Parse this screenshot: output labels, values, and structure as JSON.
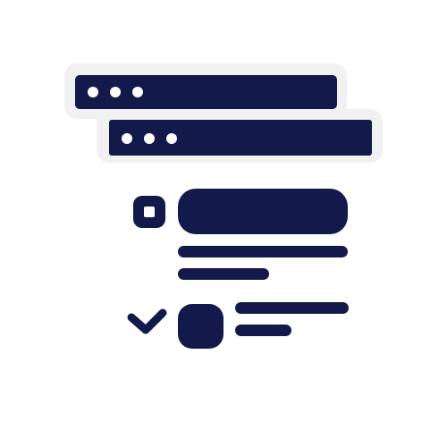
{
  "colors": {
    "primary": "#131a4b",
    "background": "#ffffff",
    "outline": "#f1f1f1",
    "dot": "#ffffff"
  },
  "icon": {
    "name": "browser-windows-checklist-icon",
    "windows": [
      {
        "name": "back-browser-window",
        "dots": 3
      },
      {
        "name": "front-browser-window",
        "dots": 3
      }
    ],
    "list_items": [
      {
        "name": "list-item-unchecked",
        "marker": "square-checkbox-icon",
        "state": "unchecked"
      },
      {
        "name": "list-item-checked",
        "marker": "checkmark-icon",
        "state": "checked"
      }
    ]
  }
}
